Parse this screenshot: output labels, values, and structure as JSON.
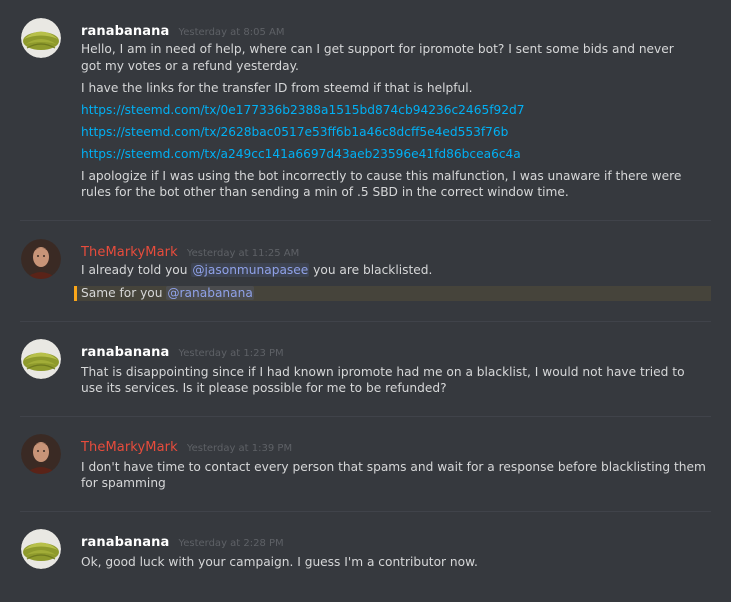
{
  "messages": [
    {
      "author": "ranabanana",
      "time": "Yesterday at 8:05 AM",
      "p1a": "Hello, I am in need of help, where can I get support for ipromote bot? I sent some bids and never",
      "p1b": "got my votes or a refund yesterday.",
      "p2": "I have the links for the transfer ID from steemd if that is helpful.",
      "link1": "https://steemd.com/tx/0e177336b2388a1515bd874cb94236c2465f92d7",
      "link2": "https://steemd.com/tx/2628bac0517e53ff6b1a46c8dcff5e4ed553f76b",
      "link3": "https://steemd.com/tx/a249cc141a6697d43aeb23596e41fd86bcea6c4a",
      "p3a": "I apologize if I was using the bot incorrectly to cause this malfunction, I was unaware if there were",
      "p3b": "rules for the bot other than sending a min of .5 SBD in the correct window time."
    },
    {
      "author": "TheMarkyMark",
      "time": "Yesterday at 11:25 AM",
      "l1_before": "I already told you ",
      "l1_mention": "@jasonmunapasee",
      "l1_after": " you are blacklisted.",
      "l2_before": "Same for you ",
      "l2_mention": "@ranabanana"
    },
    {
      "author": "ranabanana",
      "time": "Yesterday at 1:23 PM",
      "la": "That is disappointing since if I had known ipromote had me on a blacklist, I would not have tried to",
      "lb": "use its services. Is it please possible for me to be refunded?"
    },
    {
      "author": "TheMarkyMark",
      "time": "Yesterday at 1:39 PM",
      "la": "I don't have time to contact every person that spams and wait for a response before blacklisting them",
      "lb": "for spamming"
    },
    {
      "author": "ranabanana",
      "time": "Yesterday at 2:28 PM",
      "la": "Ok, good luck with your campaign. I guess I'm a contributor now."
    }
  ],
  "colors": {
    "background": "#36393e",
    "link": "#00b0f4",
    "mod_name": "#e74c3c",
    "mention": "#8fa1e8",
    "highlight_bar": "#faa61a"
  }
}
